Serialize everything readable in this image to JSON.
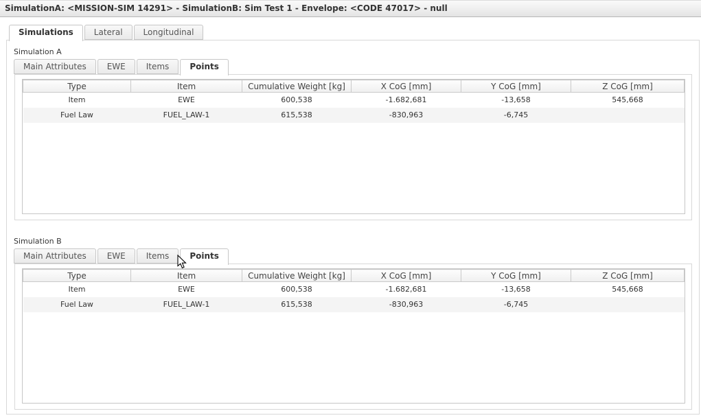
{
  "header": {
    "title": "SimulationA: <MISSION-SIM 14291> - SimulationB: Sim Test 1 - Envelope: <CODE 47017> - null"
  },
  "main_tabs": [
    {
      "label": "Simulations",
      "active": true
    },
    {
      "label": "Lateral",
      "active": false
    },
    {
      "label": "Longitudinal",
      "active": false
    }
  ],
  "sections": [
    {
      "label": "Simulation A",
      "tabs": [
        {
          "label": "Main Attributes",
          "active": false
        },
        {
          "label": "EWE",
          "active": false
        },
        {
          "label": "Items",
          "active": false
        },
        {
          "label": "Points",
          "active": true
        }
      ],
      "table": {
        "columns": [
          "Type",
          "Item",
          "Cumulative Weight [kg]",
          "X CoG [mm]",
          "Y CoG [mm]",
          "Z CoG [mm]"
        ],
        "rows": [
          [
            "Item",
            "EWE",
            "600,538",
            "-1.682,681",
            "-13,658",
            "545,668"
          ],
          [
            "Fuel Law",
            "FUEL_LAW-1",
            "615,538",
            "-830,963",
            "-6,745",
            ""
          ]
        ]
      }
    },
    {
      "label": "Simulation B",
      "tabs": [
        {
          "label": "Main Attributes",
          "active": false
        },
        {
          "label": "EWE",
          "active": false
        },
        {
          "label": "Items",
          "active": false
        },
        {
          "label": "Points",
          "active": true
        }
      ],
      "table": {
        "columns": [
          "Type",
          "Item",
          "Cumulative Weight [kg]",
          "X CoG [mm]",
          "Y CoG [mm]",
          "Z CoG [mm]"
        ],
        "rows": [
          [
            "Item",
            "EWE",
            "600,538",
            "-1.682,681",
            "-13,658",
            "545,668"
          ],
          [
            "Fuel Law",
            "FUEL_LAW-1",
            "615,538",
            "-830,963",
            "-6,745",
            ""
          ]
        ]
      }
    }
  ],
  "colors": {
    "titlebar_bg": "#e9e9e9",
    "panel_border": "#d8d8d8",
    "grid_border": "#c9c9c9",
    "row_alt_bg": "#f4f4f4",
    "text": "#333333"
  }
}
